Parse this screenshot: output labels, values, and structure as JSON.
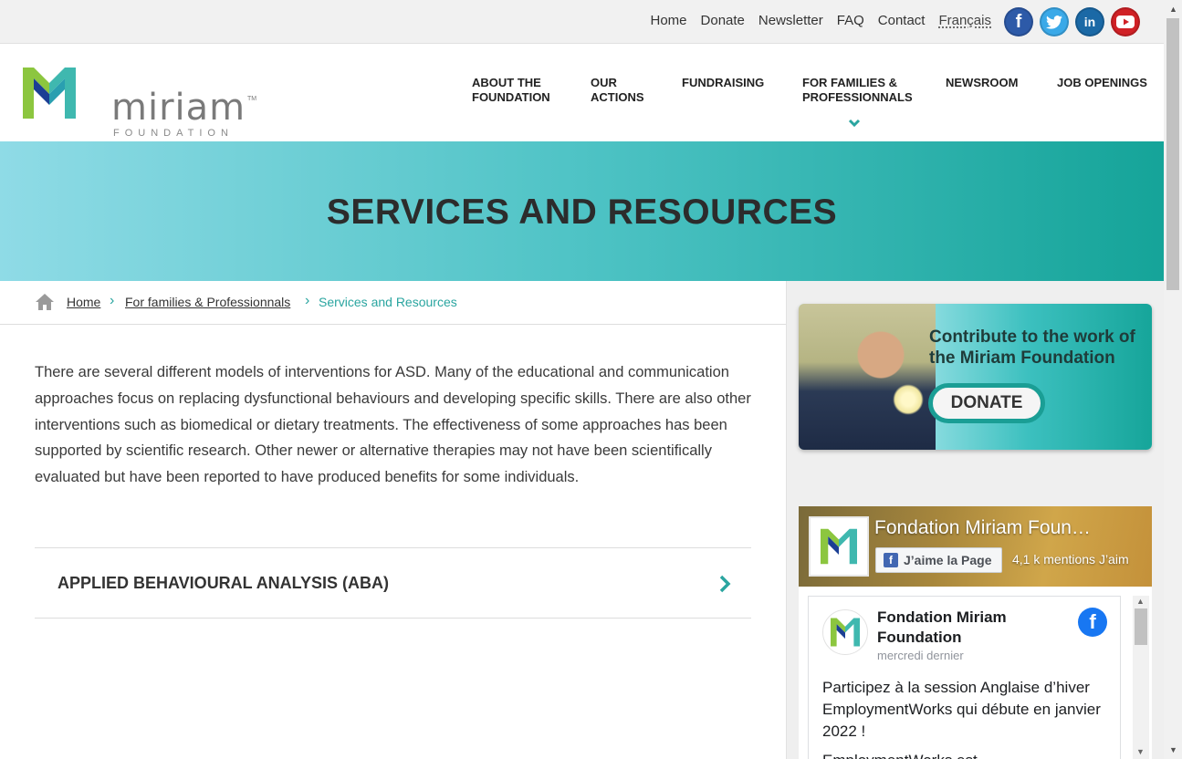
{
  "topbar": {
    "links": [
      "Home",
      "Donate",
      "Newsletter",
      "FAQ",
      "Contact"
    ],
    "language": "Français",
    "social": [
      {
        "icon": "facebook-icon",
        "glyph": "f",
        "color": "#2d5aa8"
      },
      {
        "icon": "twitter-icon",
        "glyph": "t",
        "color": "#3aa9e8"
      },
      {
        "icon": "linkedin-icon",
        "glyph": "in",
        "color": "#1b69a6"
      },
      {
        "icon": "youtube-icon",
        "glyph": "▶",
        "color": "#d02126"
      }
    ]
  },
  "logo": {
    "word": "miriam",
    "sub": "FOUNDATION",
    "tm": "TM",
    "colors": {
      "green": "#8cc63f",
      "teal": "#3fb8af",
      "blue": "#1b3f94"
    }
  },
  "nav": {
    "items": [
      {
        "line1": "ABOUT THE",
        "line2": "FOUNDATION"
      },
      {
        "line1": "OUR",
        "line2": "ACTIONS"
      },
      {
        "line1": "FUNDRAISING",
        "line2": ""
      },
      {
        "line1": "FOR FAMILIES &",
        "line2": "PROFESSIONNALS"
      },
      {
        "line1": "NEWSROOM",
        "line2": ""
      },
      {
        "line1": "JOB OPENINGS",
        "line2": ""
      }
    ],
    "active_index": 3
  },
  "banner": {
    "title": "SERVICES AND RESOURCES",
    "gradient": [
      "#8fdbe6",
      "#4ec3c5",
      "#15a499"
    ]
  },
  "breadcrumb": {
    "home": "Home",
    "parent": "For families & Professionnals",
    "current": "Services and Resources",
    "accent": "#2aa5a0"
  },
  "main": {
    "intro": "There are several different models of interventions for ASD.  Many of the educational and communication approaches focus on replacing dysfunctional behaviours and developing specific skills. There are also other interventions such as biomedical or dietary treatments. The effectiveness of some approaches has been supported by scientific research.  Other newer or alternative therapies may not have been scientifically evaluated but have been reported to have produced benefits for some individuals.",
    "accordion": [
      {
        "title": "APPLIED BEHAVIOURAL ANALYSIS (ABA)"
      }
    ]
  },
  "sidebar": {
    "donate_card": {
      "heading": "Contribute to the work of the Miriam Foundation",
      "button": "DONATE"
    },
    "facebook": {
      "page_name": "Fondation Miriam Foun…",
      "like_button": "J’aime la Page",
      "like_count": "4,1 k mentions J’aim",
      "post": {
        "author": "Fondation Miriam Foundation",
        "date": "mercredi dernier",
        "text": "Participez à la session Anglaise d’hiver EmploymentWorks qui débute en janvier 2022 !",
        "trailing": "EmploymentWorks est"
      }
    }
  }
}
